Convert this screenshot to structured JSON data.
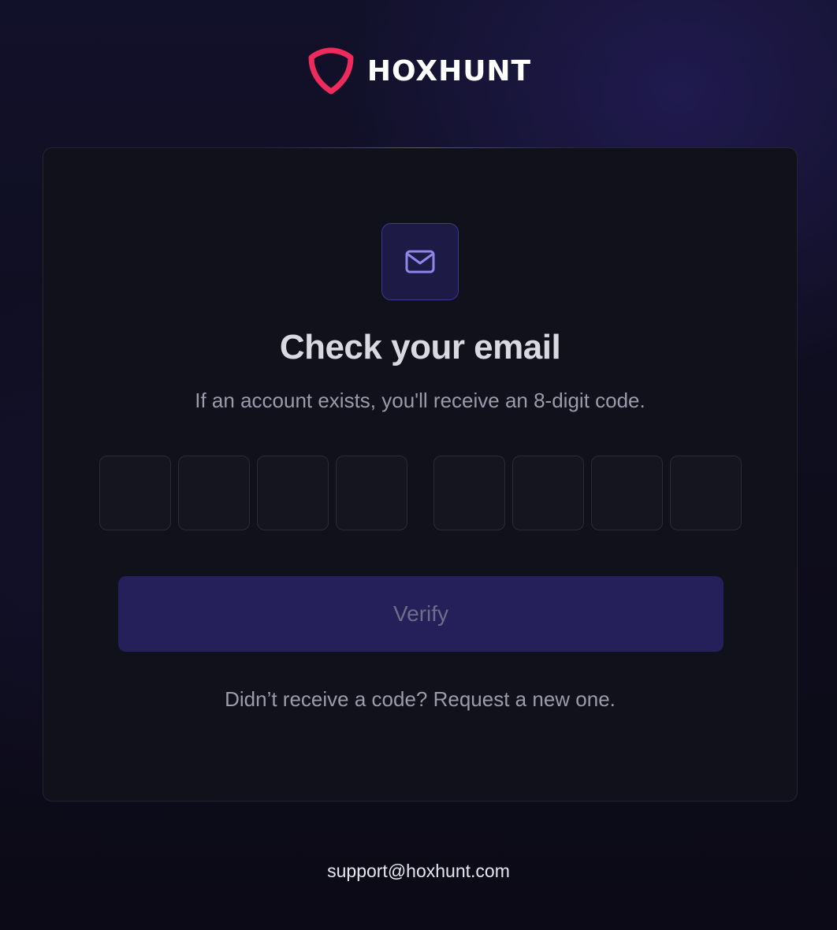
{
  "brand": {
    "name": "HOXHUNT",
    "logo_icon": "shield-icon",
    "accent_color": "#ef2b5c"
  },
  "card": {
    "icon": "mail-icon",
    "title": "Check your email",
    "subtitle": "If an account exists, you'll receive an 8-digit code.",
    "code": {
      "length": 8,
      "groups": [
        4,
        4
      ],
      "values": [
        "",
        "",
        "",
        "",
        "",
        "",
        "",
        ""
      ]
    },
    "verify_label": "Verify",
    "resend": {
      "prompt": "Didn’t receive a code?",
      "link_label": "Request a new one."
    }
  },
  "footer": {
    "support_email": "support@hoxhunt.com"
  },
  "colors": {
    "background": "#0e0d1c",
    "card": "#11111b",
    "button": "#25205a",
    "icon_tile": "#1d1b45",
    "icon_stroke": "#8d87ec"
  }
}
